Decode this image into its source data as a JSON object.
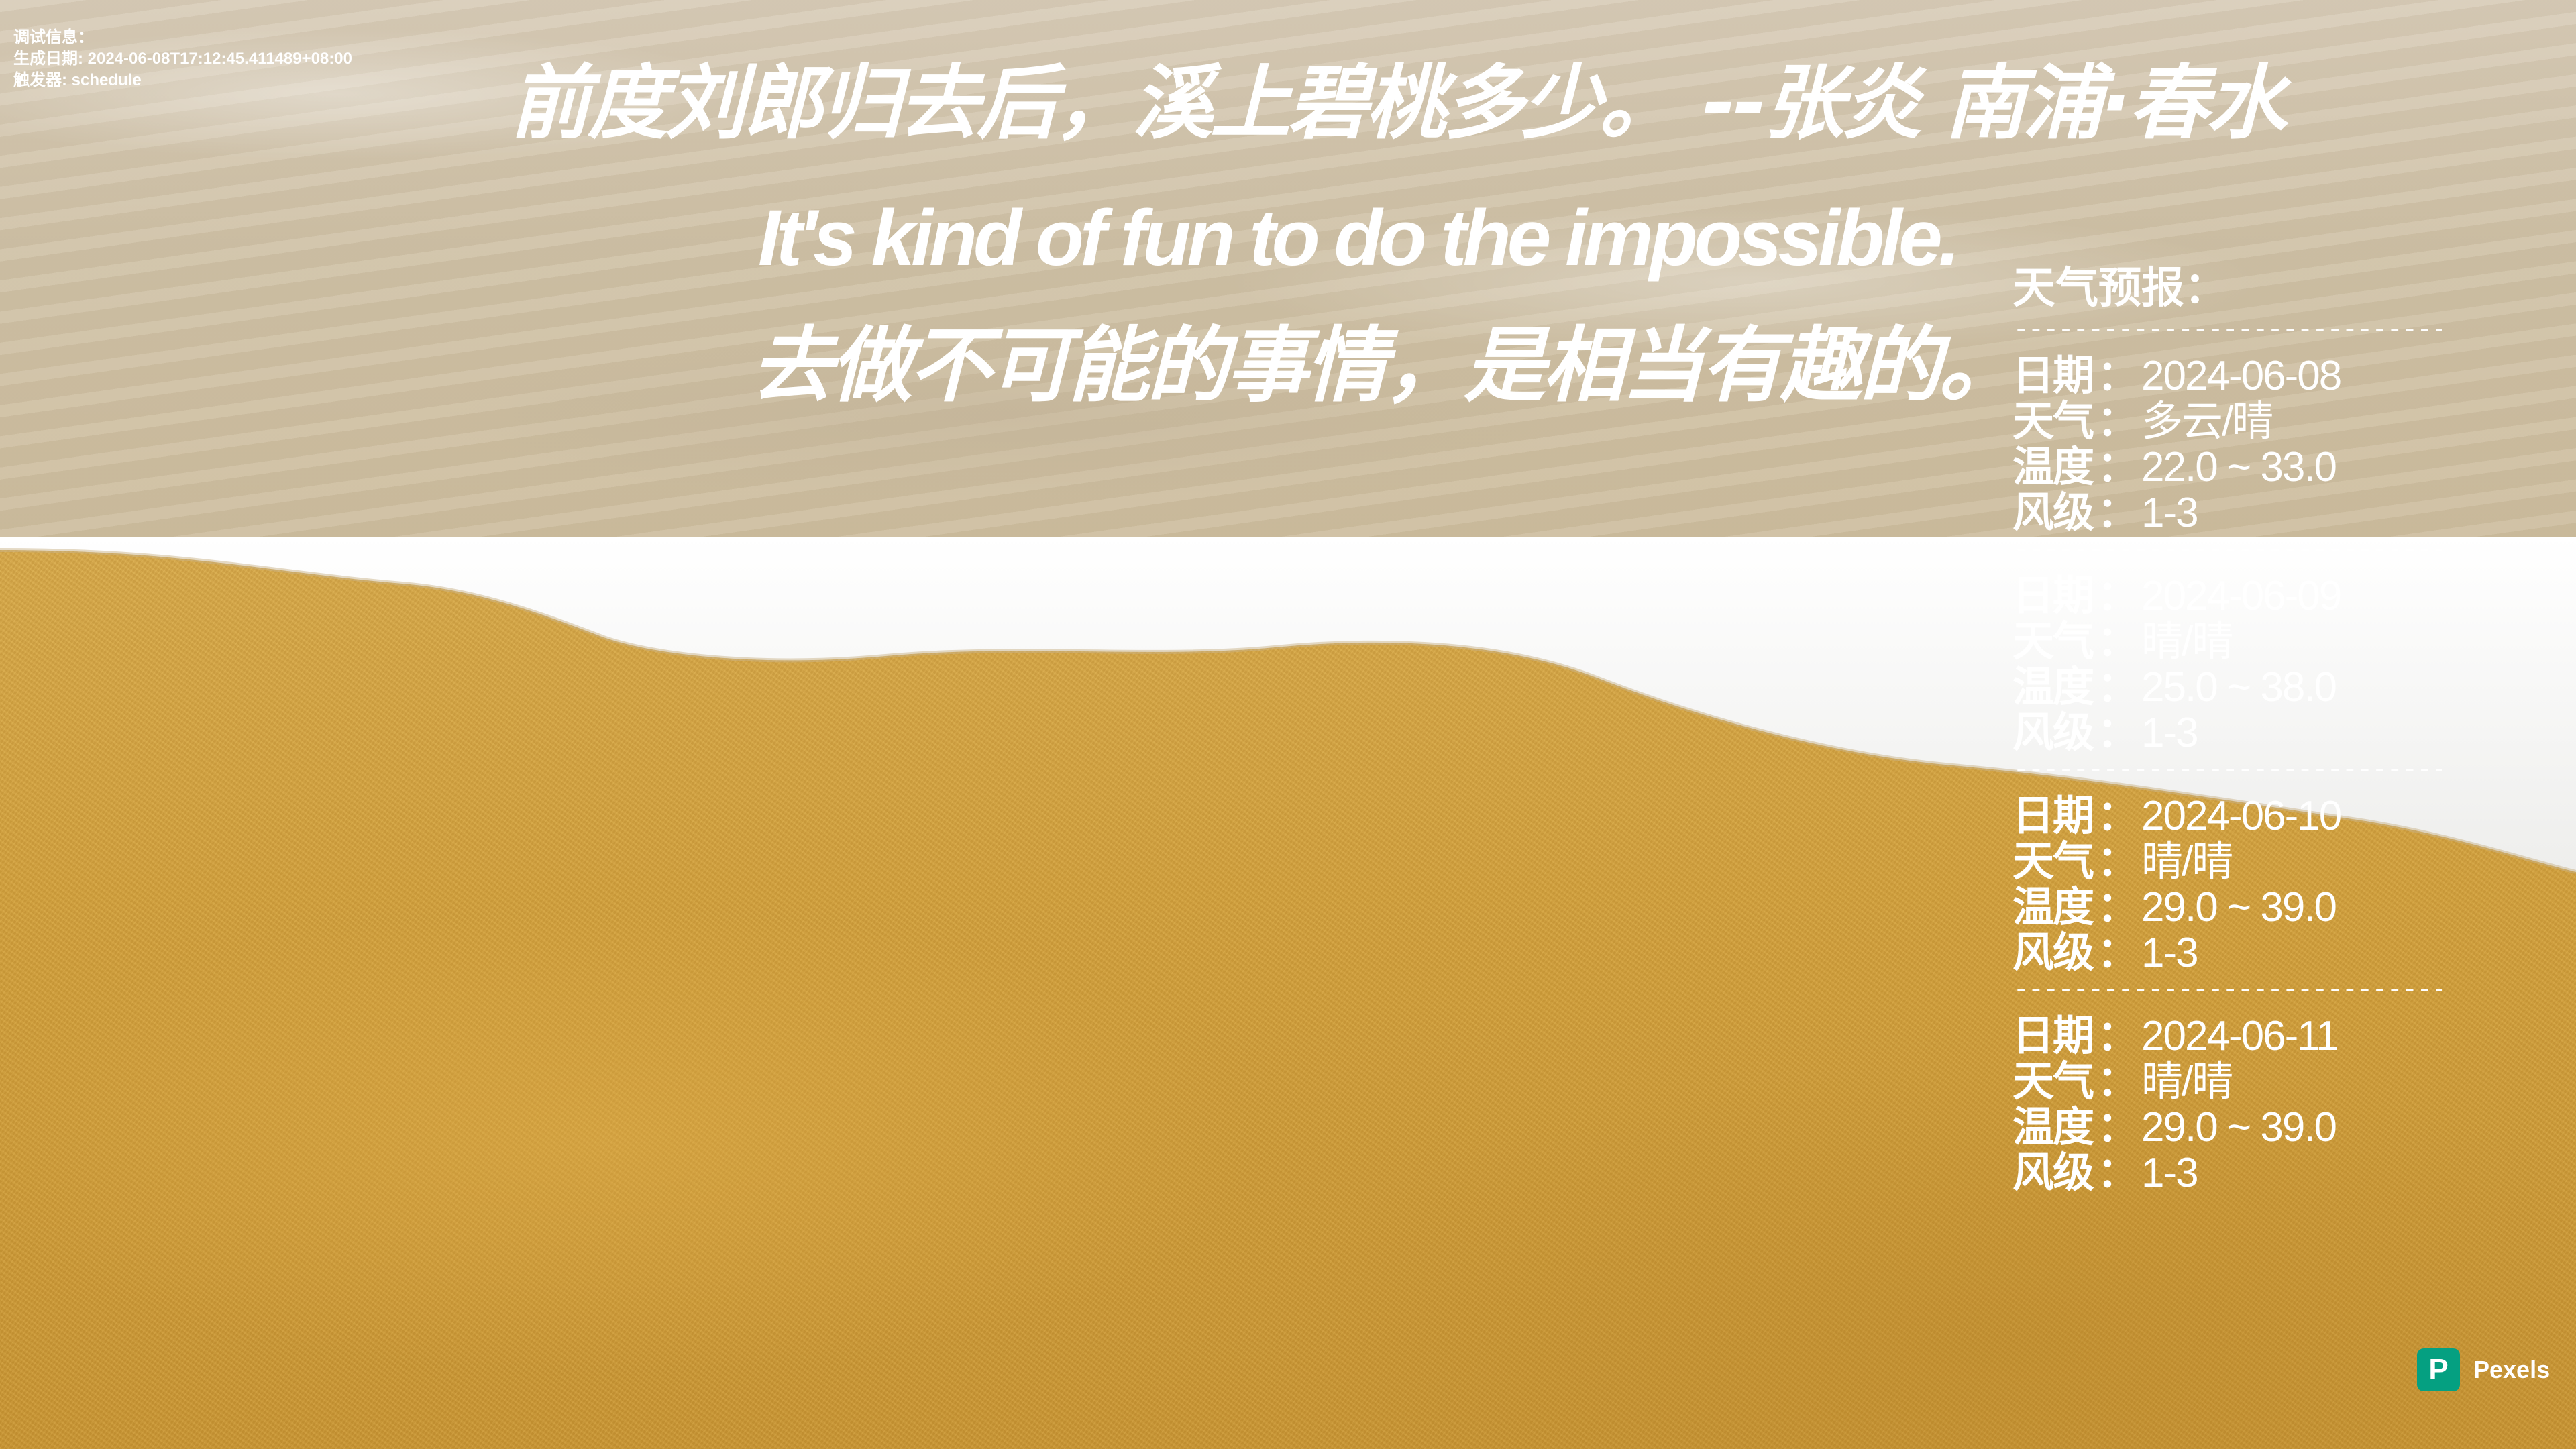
{
  "debug": {
    "title": "调试信息：",
    "generated": "生成日期: 2024-06-08T17:12:45.411489+08:00",
    "trigger": "触发器: schedule"
  },
  "quote": {
    "chinese_verse": "前度刘郎归去后，溪上碧桃多少。   --张炎 南浦·春水",
    "english": "It's kind of fun to do the impossible.",
    "translation": "去做不可能的事情，是相当有趣的。"
  },
  "weather": {
    "title": "天气预报：",
    "separator": "-------------------------------",
    "labels": {
      "date": "日期",
      "weather": "天气",
      "temperature": "温度",
      "wind": "风级",
      "colon": "："
    },
    "days": [
      {
        "date": "2024-06-08",
        "weather": "多云/晴",
        "temperature": "22.0 ~ 33.0",
        "wind": "1-3"
      },
      {
        "date": "2024-06-09",
        "weather": "晴/晴",
        "temperature": "25.0 ~ 38.0",
        "wind": "1-3"
      },
      {
        "date": "2024-06-10",
        "weather": "晴/晴",
        "temperature": "29.0 ~ 39.0",
        "wind": "1-3"
      },
      {
        "date": "2024-06-11",
        "weather": "晴/晴",
        "temperature": "29.0 ~ 39.0",
        "wind": "1-3"
      }
    ]
  },
  "credit": {
    "logo_letter": "P",
    "label": "Pexels",
    "brand_color": "#05a081"
  },
  "colors": {
    "text": "#ffffff",
    "sand": "#d2a03c",
    "water": "#cfc1a6",
    "foam": "#f7f7f5"
  }
}
